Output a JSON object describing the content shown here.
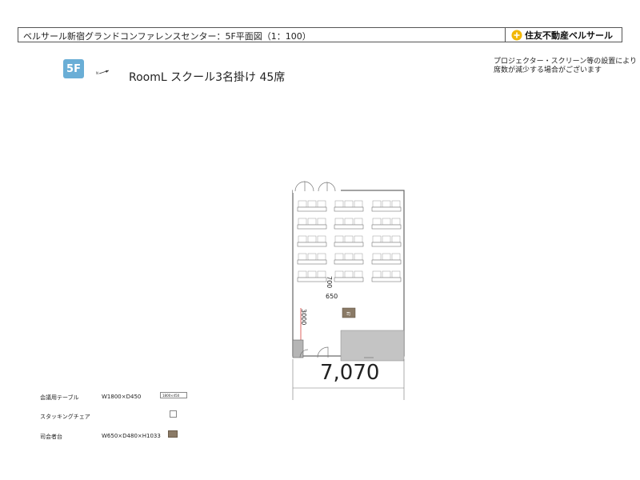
{
  "header": {
    "title": "ベルサール新宿グランドコンファレンスセンター：5F平面図（1：100）",
    "logo_text": "住友不動産ベルサール"
  },
  "floor_badge": "5F",
  "room_title": "RoomL スクール3名掛け 45席",
  "note": {
    "line1": "プロジェクター・スクリーン等の設置により",
    "line2": "席数が減少する場合がございます"
  },
  "plan": {
    "overall_width": "7,070",
    "dim_row_spacing": "700",
    "dim_aisle": "650",
    "dim_front": "3000",
    "podium_label": "司",
    "seating": {
      "table_columns": 3,
      "table_rows": 5,
      "seats_per_table": 3
    }
  },
  "legend": [
    {
      "name": "会議用テーブル",
      "spec": "W1800×D450",
      "symbol_text": "1800×450"
    },
    {
      "name": "スタッキングチェア",
      "spec": "",
      "symbol_text": ""
    },
    {
      "name": "司会者台",
      "spec": "W650×D480×H1033",
      "symbol_text": "司"
    }
  ],
  "colors": {
    "badge": "#6aaed6",
    "podium": "#8a7a66",
    "stage_area": "#c4c4c4",
    "dimension_line": "#d9534f",
    "logo_mark": "#f2b705"
  }
}
